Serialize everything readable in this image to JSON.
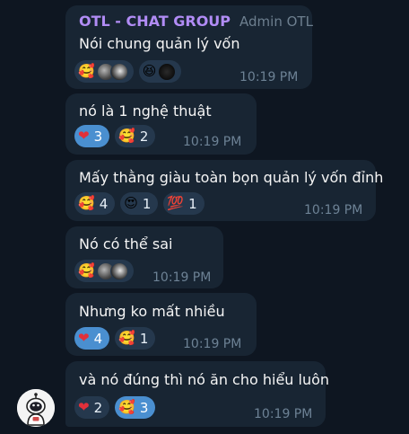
{
  "group": {
    "name": "OTL - CHAT GROUP",
    "role": "Admin OTL"
  },
  "icons": {
    "hug": "smiling-face-with-hearts",
    "heart": "red-heart",
    "heart_eyes": "smiling-face-with-heart-eyes",
    "hundred": "hundred-points",
    "grin": "grinning-squinting-face",
    "heart_color": "#e2303a",
    "chosen_reaction_color": "#4a8fd0",
    "bubble_color": "#182533",
    "sender_color": "#b18cf5"
  },
  "messages": [
    {
      "text": "Nói chung quản lý vốn",
      "time": "10:19 PM",
      "reactions": [
        {
          "emoji": "🥰",
          "kind": "avatars",
          "avatars": 2
        },
        {
          "emoji": "😆",
          "kind": "avatars",
          "avatars": 1
        }
      ]
    },
    {
      "text": "nó là 1 nghệ thuật",
      "time": "10:19 PM",
      "reactions": [
        {
          "emoji": "❤",
          "count": "3",
          "chosen": true
        },
        {
          "emoji": "🥰",
          "count": "2",
          "chosen": false
        }
      ]
    },
    {
      "text": "Mấy thằng giàu toàn bọn quản lý vốn đỉnh",
      "time": "10:19 PM",
      "reactions": [
        {
          "emoji": "🥰",
          "count": "4",
          "chosen": false
        },
        {
          "emoji": "😍",
          "count": "1",
          "chosen": false
        },
        {
          "emoji": "💯",
          "count": "1",
          "chosen": false
        }
      ]
    },
    {
      "text": "Nó có thể sai",
      "time": "10:19 PM",
      "reactions": [
        {
          "emoji": "🥰",
          "kind": "avatars",
          "avatars": 2
        }
      ]
    },
    {
      "text": "Nhưng ko mất nhiều",
      "time": "10:19 PM",
      "reactions": [
        {
          "emoji": "❤",
          "count": "4",
          "chosen": true
        },
        {
          "emoji": "🥰",
          "count": "1",
          "chosen": false
        }
      ]
    },
    {
      "text": "và nó đúng thì nó ăn cho hiểu luôn",
      "time": "10:19 PM",
      "reactions": [
        {
          "emoji": "❤",
          "count": "2",
          "chosen": false
        },
        {
          "emoji": "🥰",
          "count": "3",
          "chosen": true
        }
      ]
    }
  ]
}
